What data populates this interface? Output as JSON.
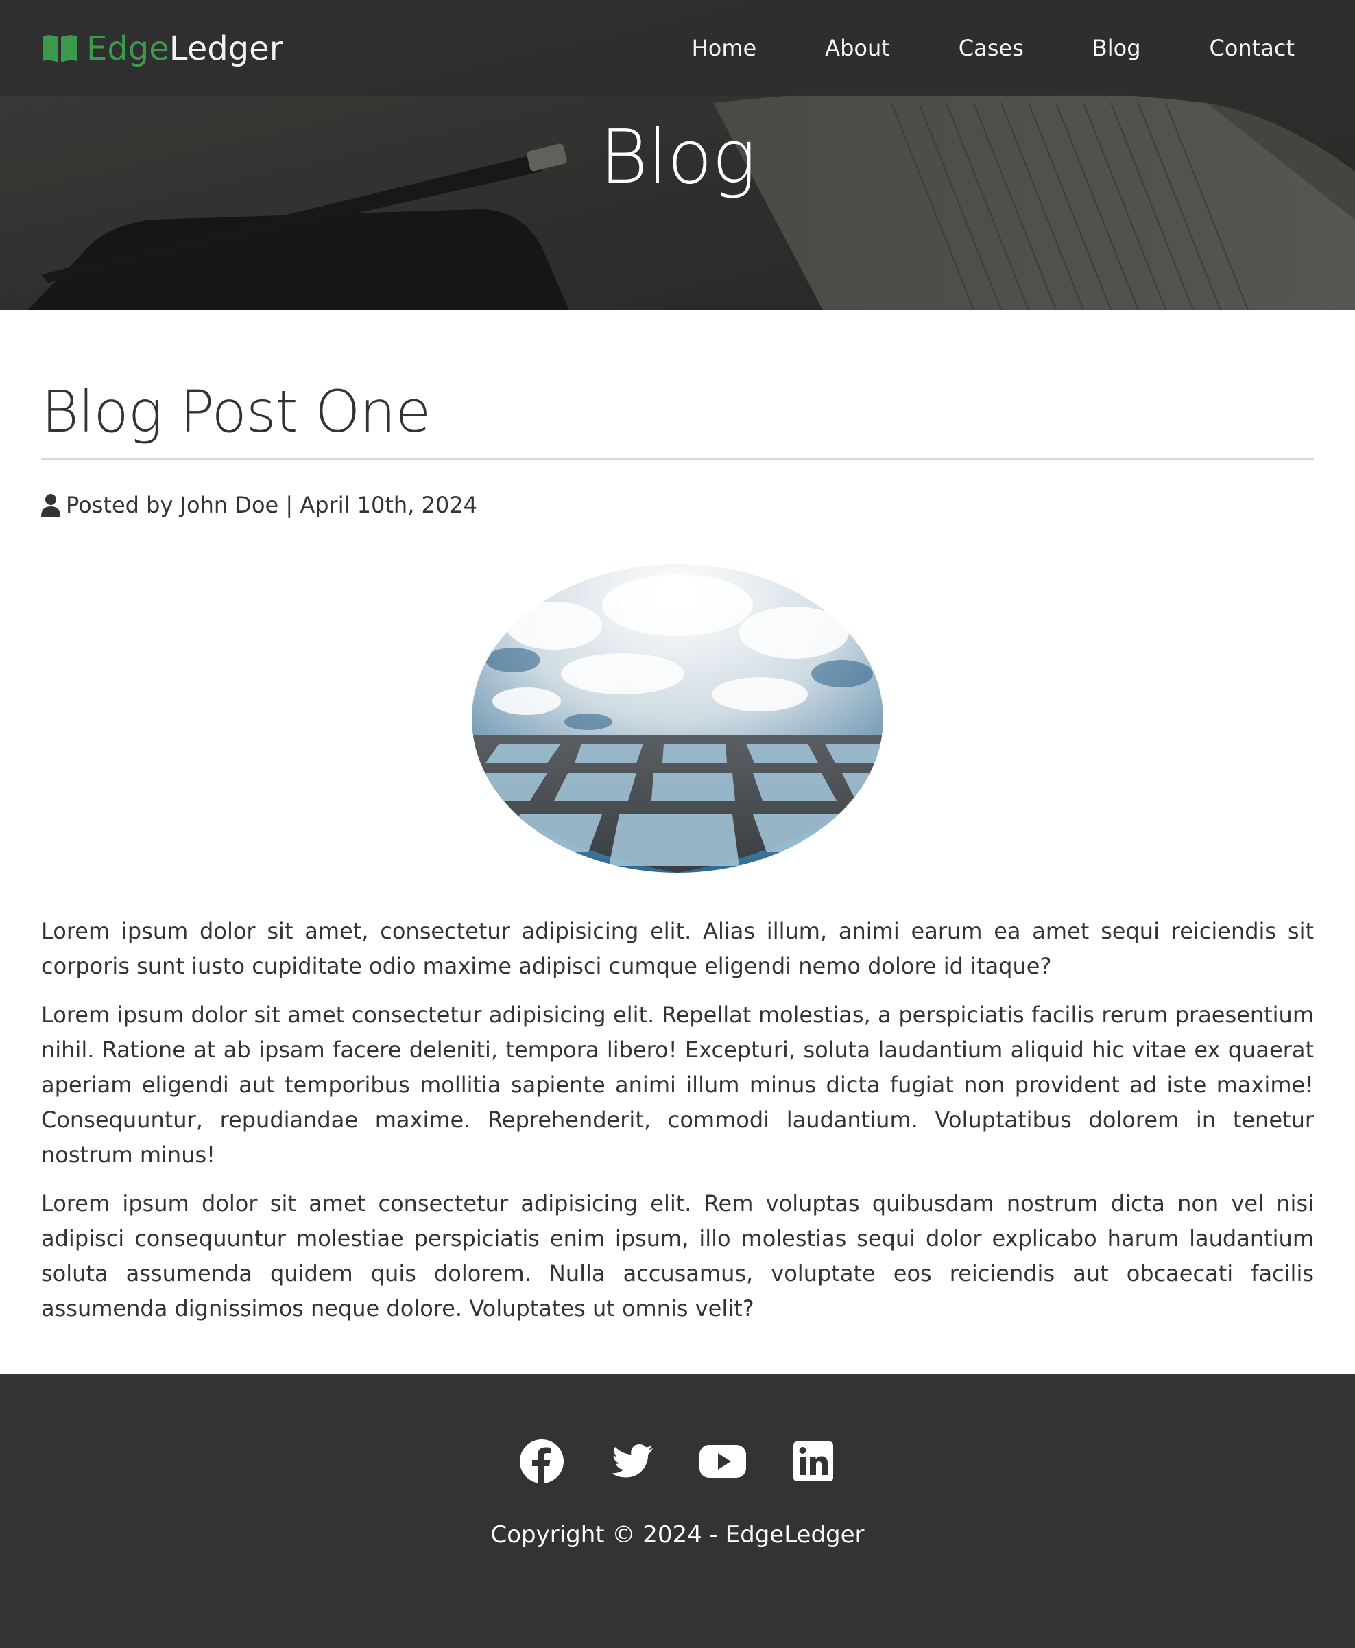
{
  "brand": {
    "part1": "Edge",
    "part2": "Ledger",
    "icon": "open-book-icon",
    "accent_color": "#3b9b4b"
  },
  "nav": {
    "items": [
      {
        "label": "Home"
      },
      {
        "label": "About"
      },
      {
        "label": "Cases"
      },
      {
        "label": "Blog"
      },
      {
        "label": "Contact"
      }
    ]
  },
  "hero": {
    "title": "Blog"
  },
  "post": {
    "title": "Blog Post One",
    "author_icon": "user-icon",
    "meta": "Posted by John Doe | April 10th, 2024",
    "image_alt": "",
    "paragraphs": [
      "Lorem ipsum dolor sit amet, consectetur adipisicing elit. Alias illum, animi earum ea amet sequi reiciendis sit corporis sunt iusto cupiditate odio maxime adipisci cumque eligendi nemo dolore id itaque?",
      "Lorem ipsum dolor sit amet consectetur adipisicing elit. Repellat molestias, a perspiciatis facilis rerum praesentium nihil. Ratione at ab ipsam facere deleniti, tempora libero! Excepturi, soluta laudantium aliquid hic vitae ex quaerat aperiam eligendi aut temporibus mollitia sapiente animi illum minus dicta fugiat non provident ad iste maxime! Consequuntur, repudiandae maxime. Reprehenderit, commodi laudantium. Voluptatibus dolorem in tenetur nostrum minus!",
      "Lorem ipsum dolor sit amet consectetur adipisicing elit. Rem voluptas quibusdam nostrum dicta non vel nisi adipisci consequuntur molestiae perspiciatis enim ipsum, illo molestias sequi dolor explicabo harum laudantium soluta assumenda quidem quis dolorem. Nulla accusamus, voluptate eos reiciendis aut obcaecati facilis assumenda dignissimos neque dolore. Voluptates ut omnis velit?"
    ]
  },
  "footer": {
    "social": [
      {
        "icon": "facebook-icon"
      },
      {
        "icon": "twitter-icon"
      },
      {
        "icon": "youtube-icon"
      },
      {
        "icon": "linkedin-icon"
      }
    ],
    "copyright": "Copyright © 2024 - EdgeLedger",
    "background_color": "#333333"
  }
}
